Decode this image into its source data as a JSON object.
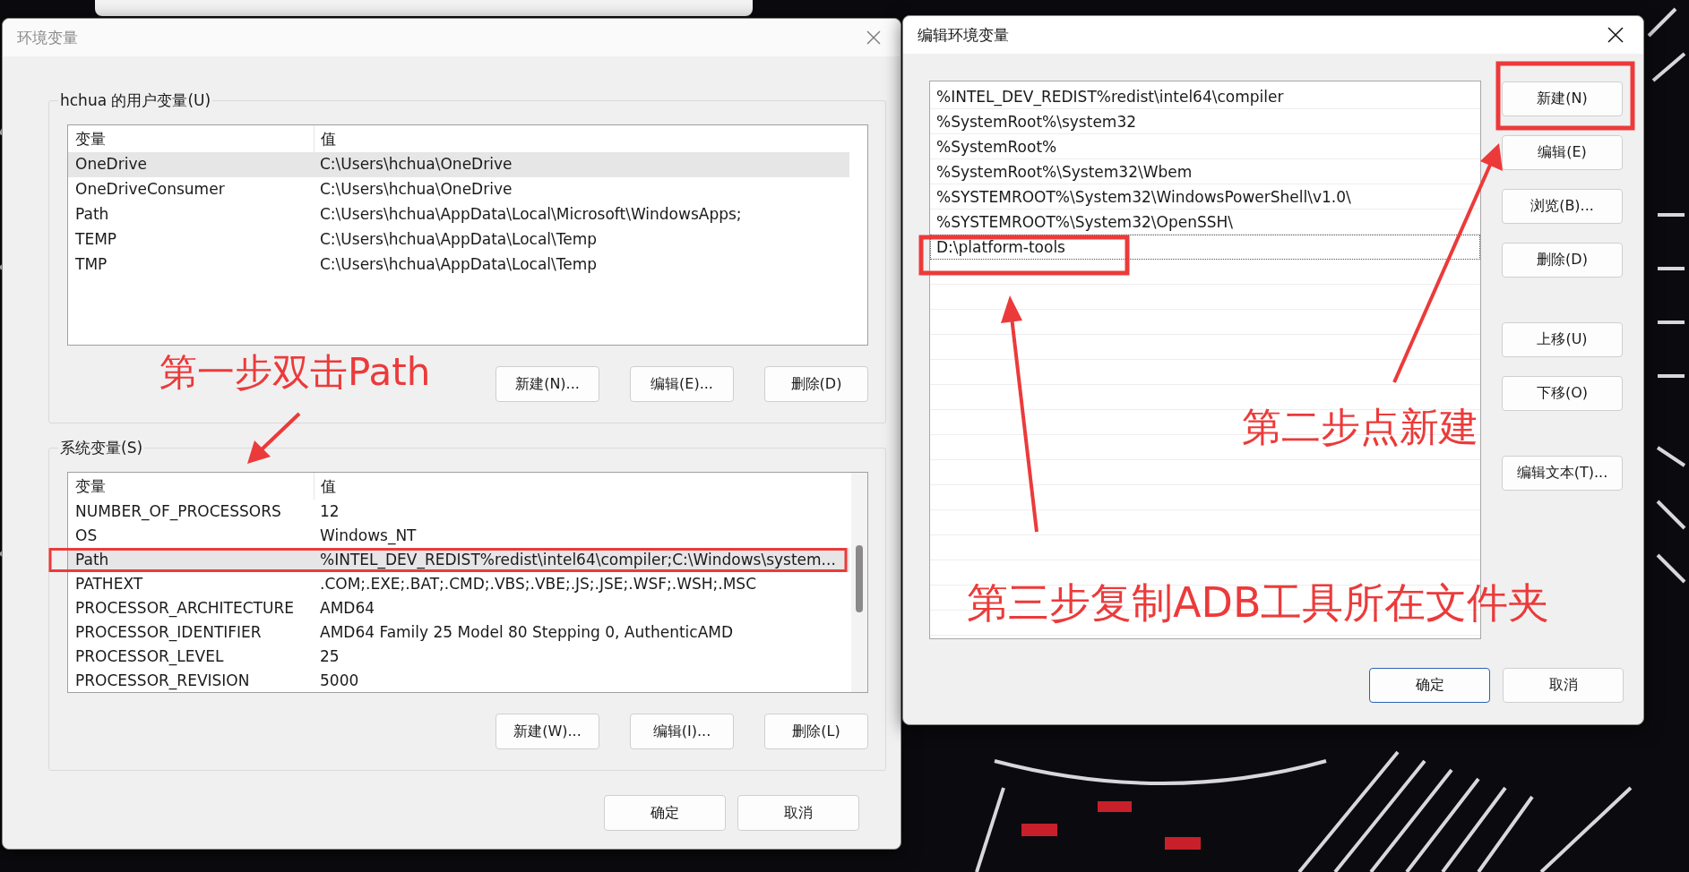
{
  "env_dialog": {
    "title": "环境变量",
    "user_group": {
      "label": "hchua 的用户变量(U)",
      "columns": [
        "变量",
        "值"
      ],
      "rows": [
        {
          "name": "OneDrive",
          "value": "C:\\Users\\hchua\\OneDrive",
          "selected": true
        },
        {
          "name": "OneDriveConsumer",
          "value": "C:\\Users\\hchua\\OneDrive",
          "selected": false
        },
        {
          "name": "Path",
          "value": "C:\\Users\\hchua\\AppData\\Local\\Microsoft\\WindowsApps;",
          "selected": false
        },
        {
          "name": "TEMP",
          "value": "C:\\Users\\hchua\\AppData\\Local\\Temp",
          "selected": false
        },
        {
          "name": "TMP",
          "value": "C:\\Users\\hchua\\AppData\\Local\\Temp",
          "selected": false
        }
      ],
      "buttons": [
        "新建(N)...",
        "编辑(E)...",
        "删除(D)"
      ]
    },
    "system_group": {
      "label": "系统变量(S)",
      "columns": [
        "变量",
        "值"
      ],
      "rows": [
        {
          "name": "NUMBER_OF_PROCESSORS",
          "value": "12",
          "selected": false
        },
        {
          "name": "OS",
          "value": "Windows_NT",
          "selected": false
        },
        {
          "name": "Path",
          "value": "%INTEL_DEV_REDIST%redist\\intel64\\compiler;C:\\Windows\\system...",
          "selected": true
        },
        {
          "name": "PATHEXT",
          "value": ".COM;.EXE;.BAT;.CMD;.VBS;.VBE;.JS;.JSE;.WSF;.WSH;.MSC",
          "selected": false
        },
        {
          "name": "PROCESSOR_ARCHITECTURE",
          "value": "AMD64",
          "selected": false
        },
        {
          "name": "PROCESSOR_IDENTIFIER",
          "value": "AMD64 Family 25 Model 80 Stepping 0, AuthenticAMD",
          "selected": false
        },
        {
          "name": "PROCESSOR_LEVEL",
          "value": "25",
          "selected": false
        },
        {
          "name": "PROCESSOR_REVISION",
          "value": "5000",
          "selected": false
        }
      ],
      "buttons": [
        "新建(W)...",
        "编辑(I)...",
        "删除(L)"
      ]
    },
    "buttons": [
      "确定",
      "取消"
    ]
  },
  "edit_dialog": {
    "title": "编辑环境变量",
    "entries": [
      {
        "text": "%INTEL_DEV_REDIST%redist\\intel64\\compiler",
        "selected": false
      },
      {
        "text": "%SystemRoot%\\system32",
        "selected": false
      },
      {
        "text": "%SystemRoot%",
        "selected": false
      },
      {
        "text": "%SystemRoot%\\System32\\Wbem",
        "selected": false
      },
      {
        "text": "%SYSTEMROOT%\\System32\\WindowsPowerShell\\v1.0\\",
        "selected": false
      },
      {
        "text": "%SYSTEMROOT%\\System32\\OpenSSH\\",
        "selected": false
      },
      {
        "text": "D:\\platform-tools",
        "selected": true
      }
    ],
    "side_buttons": [
      [
        "新建(N)",
        "编辑(E)",
        "浏览(B)...",
        "删除(D)"
      ],
      [
        "上移(U)",
        "下移(O)"
      ],
      [
        "编辑文本(T)..."
      ]
    ],
    "buttons": [
      {
        "label": "确定",
        "default": true
      },
      {
        "label": "取消",
        "default": false
      }
    ]
  },
  "annotations": [
    {
      "text": "第一步双击Path"
    },
    {
      "text": "第二步点新建"
    },
    {
      "text": "第三步复制ADB工具所在文件夹"
    }
  ]
}
